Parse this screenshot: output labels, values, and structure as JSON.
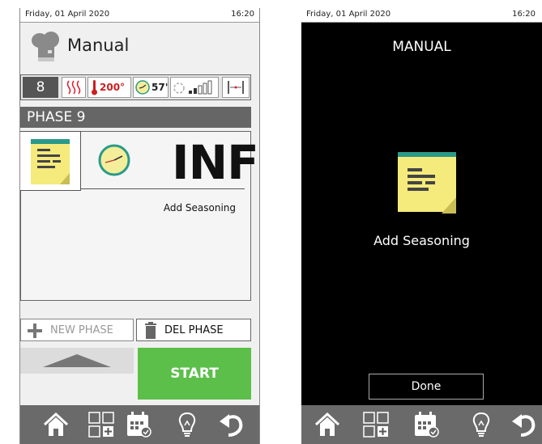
{
  "left_screen": {
    "status": {
      "date": "Friday, 01 April 2020",
      "time": "16:20"
    },
    "title": "Manual",
    "params": {
      "phase_number": "8",
      "temperature": "200°",
      "time": "57'"
    },
    "phase_header": "PHASE 9",
    "phase_card": {
      "duration": "INF",
      "description": "Add Seasoning"
    },
    "buttons": {
      "new_phase": "NEW PHASE",
      "del_phase": "DEL PHASE",
      "start": "START"
    }
  },
  "right_screen": {
    "status": {
      "date": "Friday, 01 April 2020",
      "time": "16:20"
    },
    "title": "MANUAL",
    "description": "Add Seasoning",
    "done": "Done"
  },
  "nav": {
    "icons": [
      "home-icon",
      "add-program-icon",
      "calendar-icon",
      "light-bulb-icon",
      "back-icon"
    ]
  },
  "colors": {
    "start_green": "#5cbf4a",
    "header_grey": "#666666",
    "note_yellow": "#f5ea7c",
    "note_teal": "#2a9a88",
    "temp_red": "#cc1f1f"
  }
}
